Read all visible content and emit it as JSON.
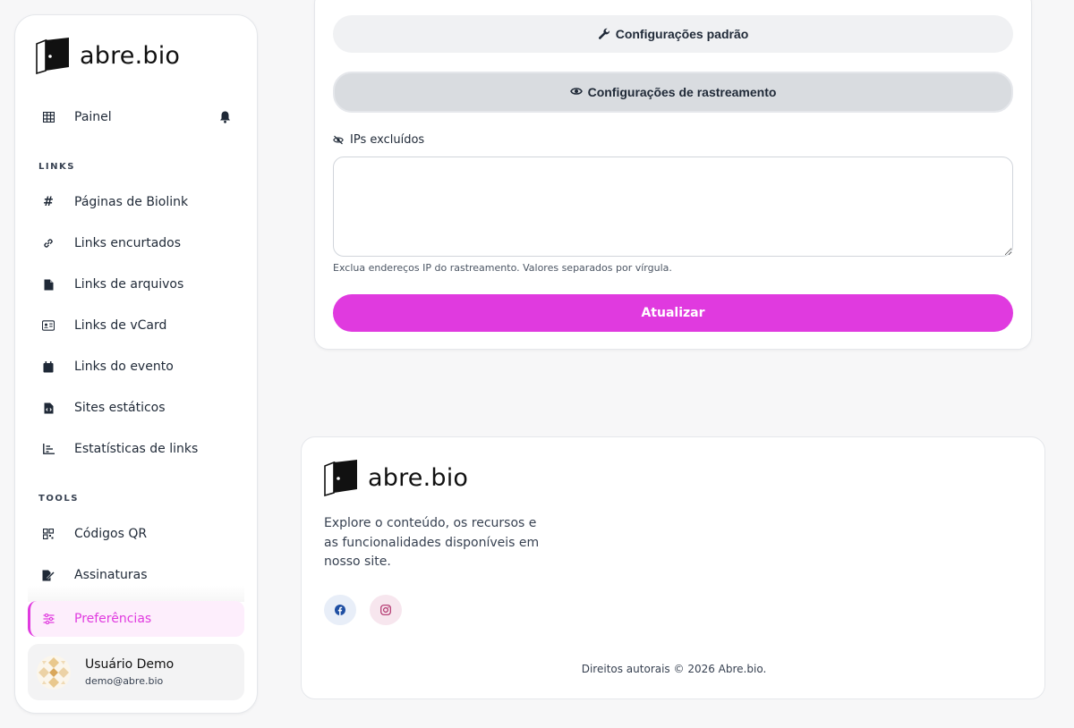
{
  "brand": {
    "name": "abre.bio",
    "accent": "#e03adf"
  },
  "sidebar": {
    "dashboard_label": "Painel",
    "sections": {
      "links_title": "LINKS",
      "tools_title": "TOOLS"
    },
    "links": [
      {
        "label": "Páginas de Biolink",
        "icon": "hash-icon"
      },
      {
        "label": "Links encurtados",
        "icon": "link-icon"
      },
      {
        "label": "Links de arquivos",
        "icon": "file-icon"
      },
      {
        "label": "Links de vCard",
        "icon": "id-card-icon"
      },
      {
        "label": "Links do evento",
        "icon": "calendar-icon"
      },
      {
        "label": "Sites estáticos",
        "icon": "file-code-icon"
      },
      {
        "label": "Estatísticas de links",
        "icon": "chart-icon"
      }
    ],
    "tools": [
      {
        "label": "Códigos QR",
        "icon": "qr-code-icon"
      },
      {
        "label": "Assinaturas",
        "icon": "signature-icon"
      }
    ],
    "active_label": "Preferências",
    "user": {
      "name": "Usuário Demo",
      "email": "demo@abre.bio"
    }
  },
  "settings": {
    "default_settings_label": "Configurações padrão",
    "tracking_settings_label": "Configurações de rastreamento",
    "excluded_ips_label": "IPs excluídos",
    "excluded_ips_value": "",
    "excluded_ips_help": "Exclua endereços IP do rastreamento. Valores separados por vírgula.",
    "submit_label": "Atualizar"
  },
  "footer": {
    "description": "Explore o conteúdo, os recursos e as funcionalidades disponíveis em nosso site.",
    "copyright": "Direitos autorais © 2026 Abre.bio."
  }
}
